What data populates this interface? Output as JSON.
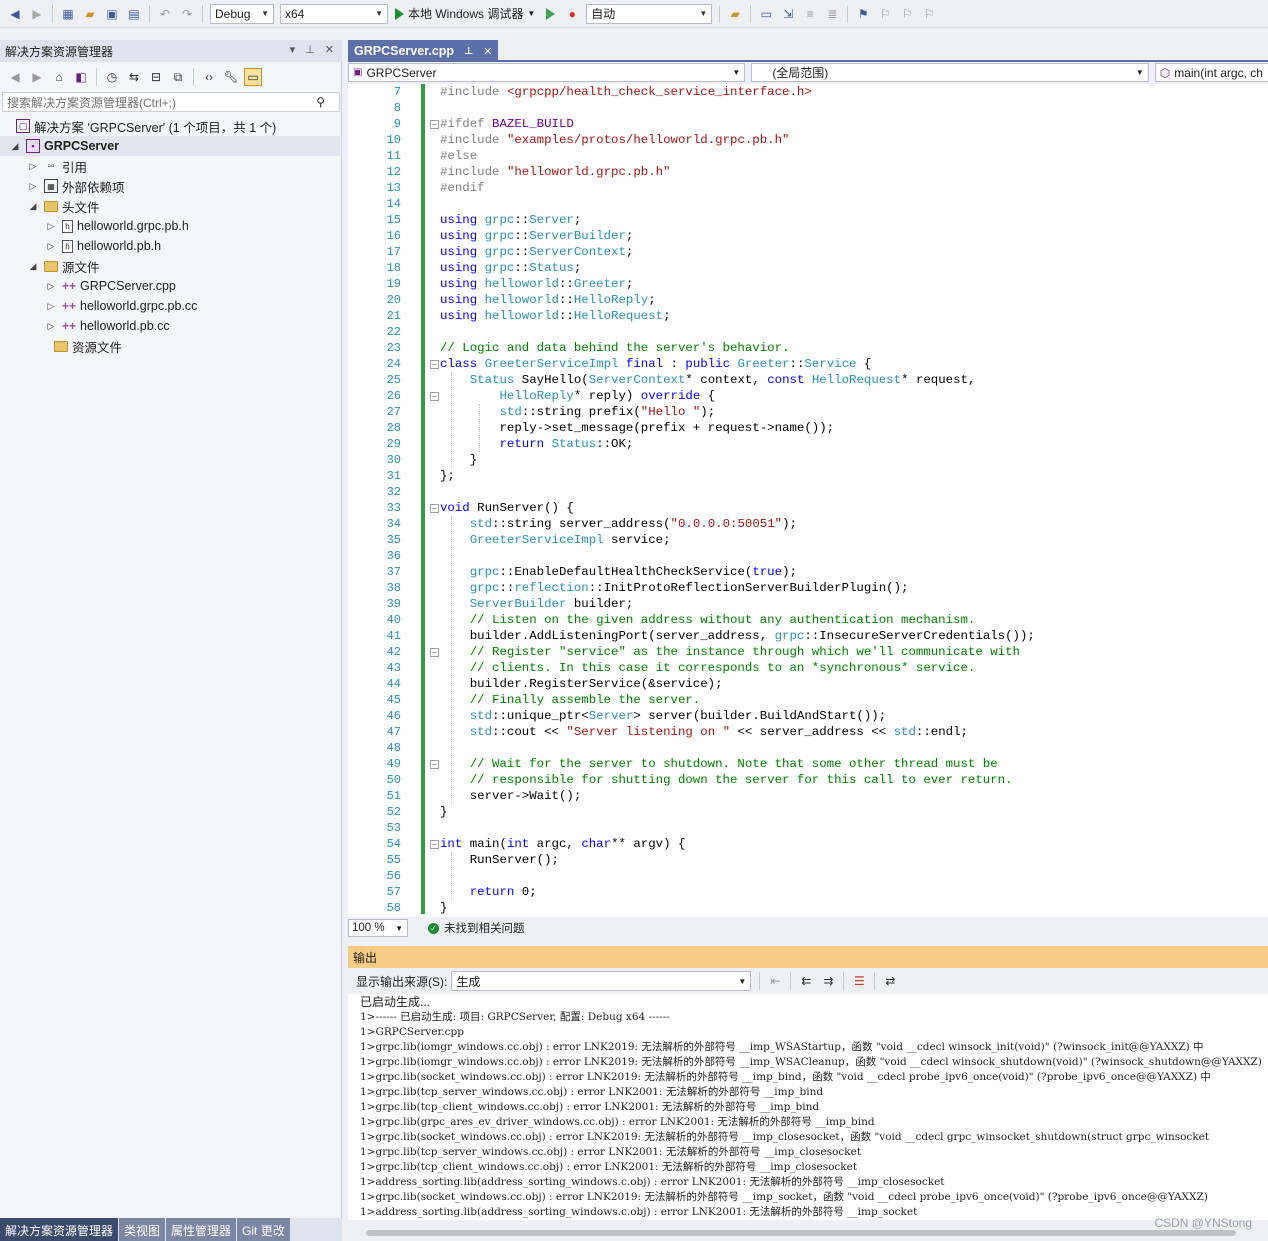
{
  "toolbar": {
    "config": "Debug",
    "platform": "x64",
    "run_label": "本地 Windows 调试器",
    "mode": "自动"
  },
  "solution_explorer": {
    "title": "解决方案资源管理器",
    "search_placeholder": "搜索解决方案资源管理器(Ctrl+;)",
    "items": [
      {
        "label": "解决方案 'GRPCServer' (1 个项目，共 1 个)",
        "icon": "solution-icon"
      },
      {
        "label": "GRPCServer",
        "icon": "project-icon"
      },
      {
        "label": "引用",
        "icon": "references-icon"
      },
      {
        "label": "外部依赖项",
        "icon": "external-deps-icon"
      },
      {
        "label": "头文件",
        "icon": "folder-icon"
      },
      {
        "label": "helloworld.grpc.pb.h",
        "icon": "header-file-icon"
      },
      {
        "label": "helloworld.pb.h",
        "icon": "header-file-icon"
      },
      {
        "label": "源文件",
        "icon": "folder-icon"
      },
      {
        "label": "GRPCServer.cpp",
        "icon": "cpp-file-icon"
      },
      {
        "label": "helloworld.grpc.pb.cc",
        "icon": "cpp-file-icon"
      },
      {
        "label": "helloworld.pb.cc",
        "icon": "cpp-file-icon"
      },
      {
        "label": "资源文件",
        "icon": "folder-icon"
      }
    ],
    "bottom_tabs": [
      "解决方案资源管理器",
      "类视图",
      "属性管理器",
      "Git 更改"
    ]
  },
  "editor": {
    "tab_title": "GRPCServer.cpp",
    "nav_project": "GRPCServer",
    "nav_scope": "(全局范围)",
    "nav_member": "main(int argc, ch",
    "zoom": "100 %",
    "status": "未找到相关问题",
    "lines": [
      {
        "n": "7",
        "t": "#include <grpcpp/health_check_service_interface.h>"
      },
      {
        "n": "8",
        "t": ""
      },
      {
        "n": "9",
        "t": "#ifdef BAZEL_BUILD"
      },
      {
        "n": "10",
        "t": "#include \"examples/protos/helloworld.grpc.pb.h\""
      },
      {
        "n": "11",
        "t": "#else"
      },
      {
        "n": "12",
        "t": "#include \"helloworld.grpc.pb.h\""
      },
      {
        "n": "13",
        "t": "#endif"
      },
      {
        "n": "14",
        "t": ""
      },
      {
        "n": "15",
        "t": "using grpc::Server;"
      },
      {
        "n": "16",
        "t": "using grpc::ServerBuilder;"
      },
      {
        "n": "17",
        "t": "using grpc::ServerContext;"
      },
      {
        "n": "18",
        "t": "using grpc::Status;"
      },
      {
        "n": "19",
        "t": "using helloworld::Greeter;"
      },
      {
        "n": "20",
        "t": "using helloworld::HelloReply;"
      },
      {
        "n": "21",
        "t": "using helloworld::HelloRequest;"
      },
      {
        "n": "22",
        "t": ""
      },
      {
        "n": "23",
        "t": "// Logic and data behind the server's behavior."
      },
      {
        "n": "24",
        "t": "class GreeterServiceImpl final : public Greeter::Service {"
      },
      {
        "n": "25",
        "t": "    Status SayHello(ServerContext* context, const HelloRequest* request,"
      },
      {
        "n": "26",
        "t": "        HelloReply* reply) override {"
      },
      {
        "n": "27",
        "t": "        std::string prefix(\"Hello \");"
      },
      {
        "n": "28",
        "t": "        reply->set_message(prefix + request->name());"
      },
      {
        "n": "29",
        "t": "        return Status::OK;"
      },
      {
        "n": "30",
        "t": "    }"
      },
      {
        "n": "31",
        "t": "};"
      },
      {
        "n": "32",
        "t": ""
      },
      {
        "n": "33",
        "t": "void RunServer() {"
      },
      {
        "n": "34",
        "t": "    std::string server_address(\"0.0.0.0:50051\");"
      },
      {
        "n": "35",
        "t": "    GreeterServiceImpl service;"
      },
      {
        "n": "36",
        "t": ""
      },
      {
        "n": "37",
        "t": "    grpc::EnableDefaultHealthCheckService(true);"
      },
      {
        "n": "38",
        "t": "    grpc::reflection::InitProtoReflectionServerBuilderPlugin();"
      },
      {
        "n": "39",
        "t": "    ServerBuilder builder;"
      },
      {
        "n": "40",
        "t": "    // Listen on the given address without any authentication mechanism."
      },
      {
        "n": "41",
        "t": "    builder.AddListeningPort(server_address, grpc::InsecureServerCredentials());"
      },
      {
        "n": "42",
        "t": "    // Register \"service\" as the instance through which we'll communicate with"
      },
      {
        "n": "43",
        "t": "    // clients. In this case it corresponds to an *synchronous* service."
      },
      {
        "n": "44",
        "t": "    builder.RegisterService(&service);"
      },
      {
        "n": "45",
        "t": "    // Finally assemble the server."
      },
      {
        "n": "46",
        "t": "    std::unique_ptr<Server> server(builder.BuildAndStart());"
      },
      {
        "n": "47",
        "t": "    std::cout << \"Server listening on \" << server_address << std::endl;"
      },
      {
        "n": "48",
        "t": ""
      },
      {
        "n": "49",
        "t": "    // Wait for the server to shutdown. Note that some other thread must be"
      },
      {
        "n": "50",
        "t": "    // responsible for shutting down the server for this call to ever return."
      },
      {
        "n": "51",
        "t": "    server->Wait();"
      },
      {
        "n": "52",
        "t": "}"
      },
      {
        "n": "53",
        "t": ""
      },
      {
        "n": "54",
        "t": "int main(int argc, char** argv) {"
      },
      {
        "n": "55",
        "t": "    RunServer();"
      },
      {
        "n": "56",
        "t": ""
      },
      {
        "n": "57",
        "t": "    return 0;"
      },
      {
        "n": "58",
        "t": "}"
      }
    ]
  },
  "output": {
    "title": "输出",
    "source_label": "显示输出来源(S):",
    "source_value": "生成",
    "lines": [
      "已启动生成...",
      "1>------ 已启动生成: 项目: GRPCServer, 配置: Debug x64 ------",
      "1>GRPCServer.cpp",
      "1>grpc.lib(iomgr_windows.cc.obj) : error LNK2019: 无法解析的外部符号 __imp_WSAStartup，函数 \"void __cdecl winsock_init(void)\" (?winsock_init@@YAXXZ) 中",
      "1>grpc.lib(iomgr_windows.cc.obj) : error LNK2019: 无法解析的外部符号 __imp_WSACleanup，函数 \"void __cdecl winsock_shutdown(void)\" (?winsock_shutdown@@YAXXZ)",
      "1>grpc.lib(socket_windows.cc.obj) : error LNK2019: 无法解析的外部符号 __imp_bind，函数 \"void __cdecl probe_ipv6_once(void)\" (?probe_ipv6_once@@YAXXZ) 中",
      "1>grpc.lib(tcp_server_windows.cc.obj) : error LNK2001: 无法解析的外部符号 __imp_bind",
      "1>grpc.lib(tcp_client_windows.cc.obj) : error LNK2001: 无法解析的外部符号 __imp_bind",
      "1>grpc.lib(grpc_ares_ev_driver_windows.cc.obj) : error LNK2001: 无法解析的外部符号 __imp_bind",
      "1>grpc.lib(socket_windows.cc.obj) : error LNK2019: 无法解析的外部符号 __imp_closesocket，函数 \"void __cdecl grpc_winsocket_shutdown(struct grpc_winsocket",
      "1>grpc.lib(tcp_server_windows.cc.obj) : error LNK2001: 无法解析的外部符号 __imp_closesocket",
      "1>grpc.lib(tcp_client_windows.cc.obj) : error LNK2001: 无法解析的外部符号 __imp_closesocket",
      "1>address_sorting.lib(address_sorting_windows.c.obj) : error LNK2001: 无法解析的外部符号 __imp_closesocket",
      "1>grpc.lib(socket_windows.cc.obj) : error LNK2019: 无法解析的外部符号 __imp_socket，函数 \"void __cdecl probe_ipv6_once(void)\" (?probe_ipv6_once@@YAXXZ)",
      "1>address_sorting.lib(address_sorting_windows.c.obj) : error LNK2001: 无法解析的外部符号 __imp_socket"
    ]
  },
  "watermark": "CSDN @YNStong"
}
